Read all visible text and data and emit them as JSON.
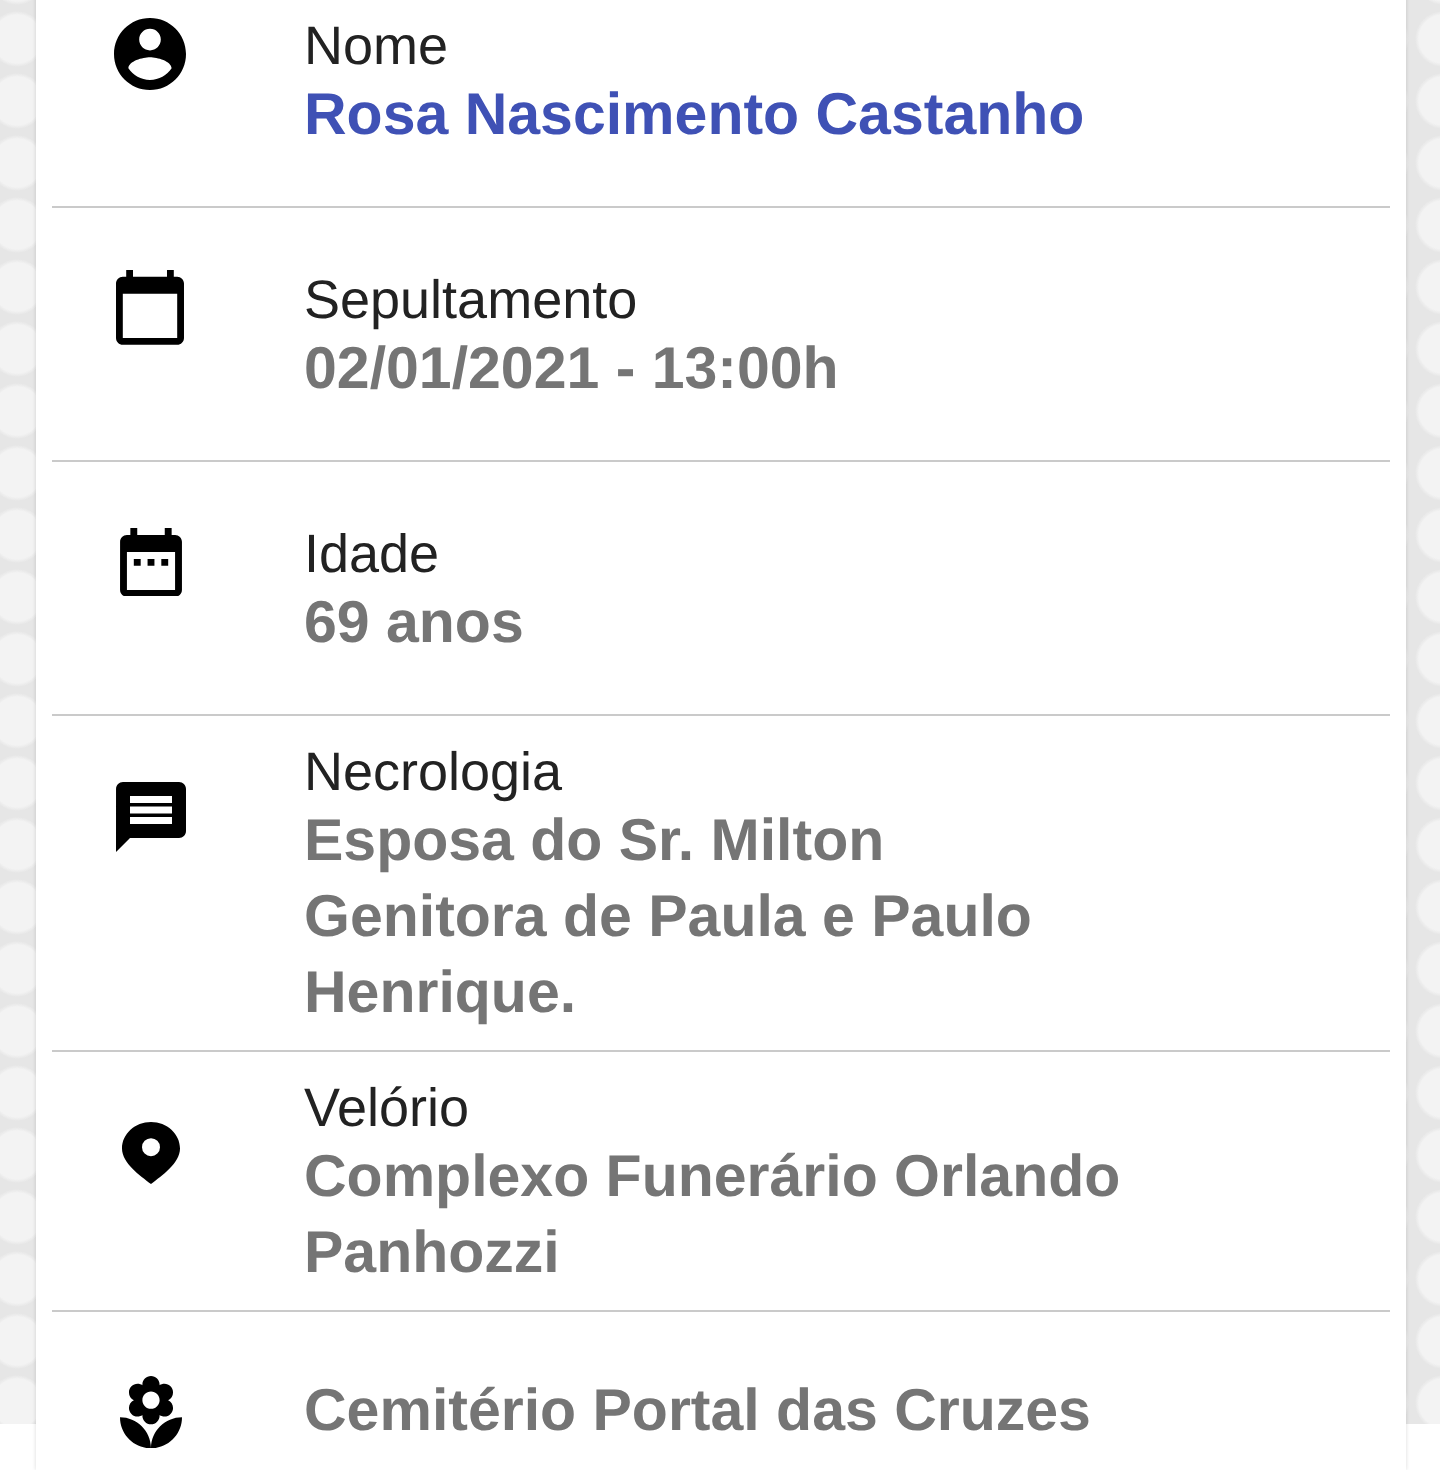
{
  "details": [
    {
      "kind": "name",
      "label": "Nome",
      "value": "Rosa Nascimento Castanho"
    },
    {
      "kind": "detail",
      "label": "Sepultamento",
      "value": "02/01/2021 - 13:00h"
    },
    {
      "kind": "detail",
      "label": "Idade",
      "value": "69 anos"
    },
    {
      "kind": "detail",
      "label": "Necrologia",
      "value": "Esposa do Sr. Milton\nGenitora de Paula e Paulo Henrique."
    },
    {
      "kind": "detail",
      "label": "Velório",
      "value": "Complexo Funerário Orlando Panhozzi"
    },
    {
      "kind": "detail",
      "value": "Cemitério Portal das Cruzes"
    }
  ]
}
